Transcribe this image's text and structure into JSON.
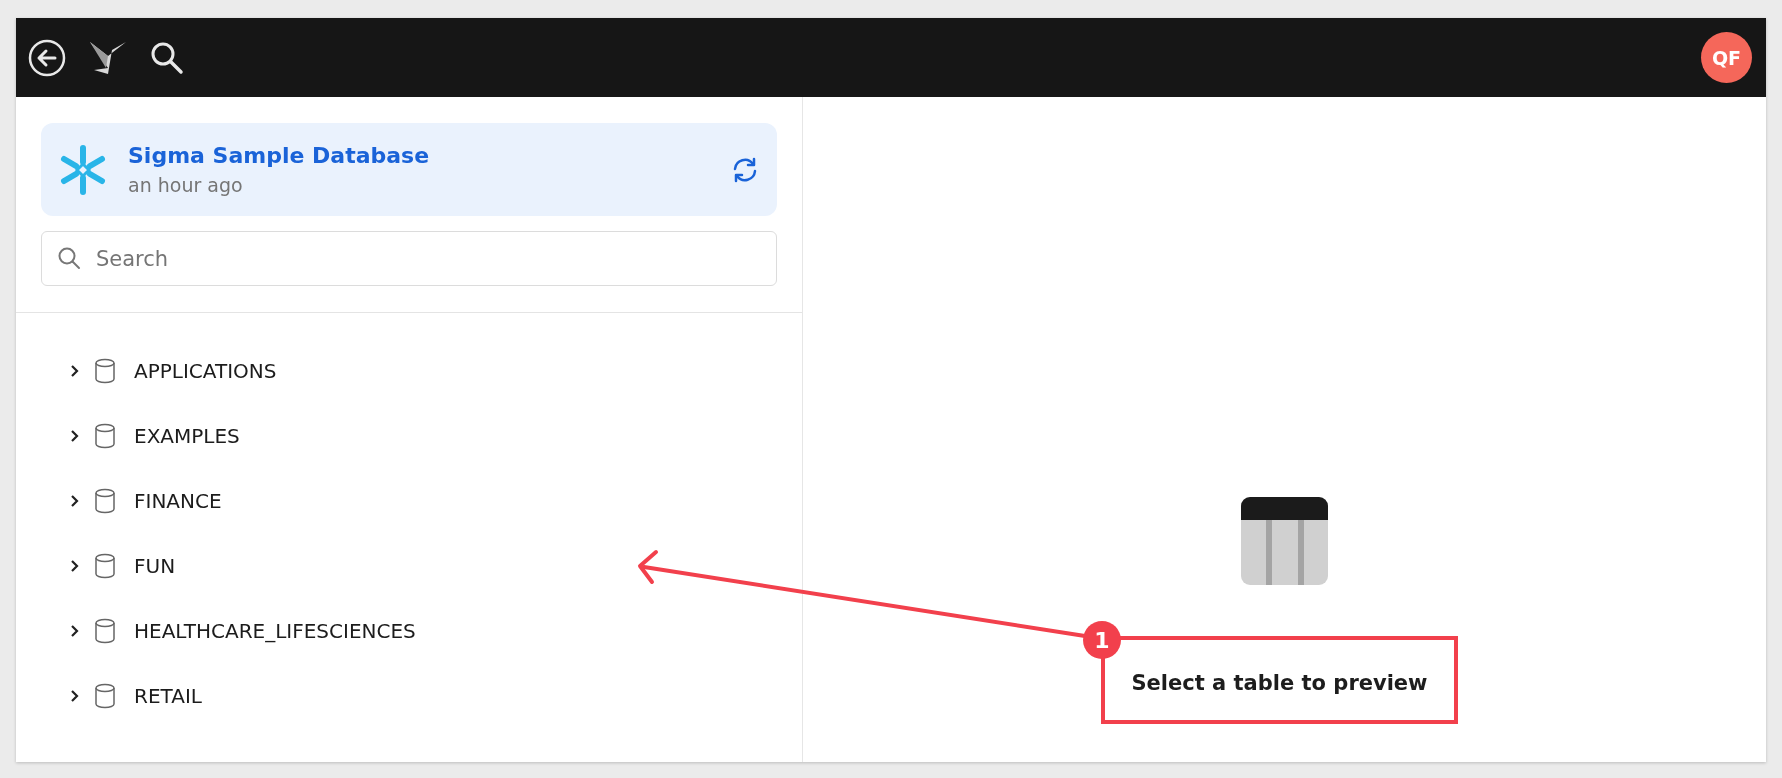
{
  "top_bar": {
    "avatar": "QF"
  },
  "connection": {
    "name": "Sigma Sample Database",
    "updated": "an hour ago"
  },
  "search": {
    "placeholder": "Search"
  },
  "databases": [
    {
      "name": "APPLICATIONS",
      "expanded": false
    },
    {
      "name": "EXAMPLES",
      "expanded": false
    },
    {
      "name": "FINANCE",
      "expanded": false
    },
    {
      "name": "FUN",
      "expanded": false
    },
    {
      "name": "HEALTHCARE_LIFESCIENCES",
      "expanded": false
    },
    {
      "name": "RETAIL",
      "expanded": false
    }
  ],
  "annotation": {
    "number": "1",
    "text": "Select a table to preview"
  }
}
